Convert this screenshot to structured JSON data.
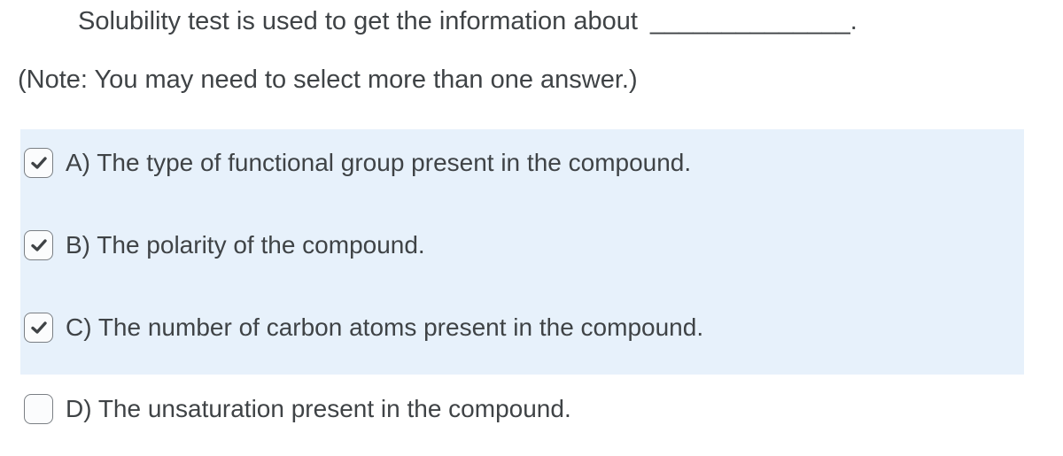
{
  "question": {
    "text": "Solubility test is used to get the information about",
    "blank": "______________."
  },
  "note": "(Note: You may need to select more than one answer.)",
  "colors": {
    "highlight": "#e7f1fb",
    "text": "#3f4346"
  },
  "options": [
    {
      "label": "A) The type of functional group present in the compound.",
      "checked": true
    },
    {
      "label": "B) The polarity of the compound.",
      "checked": true
    },
    {
      "label": "C) The number of carbon atoms present in the compound.",
      "checked": true
    },
    {
      "label": "D) The unsaturation present in the compound.",
      "checked": false
    }
  ]
}
